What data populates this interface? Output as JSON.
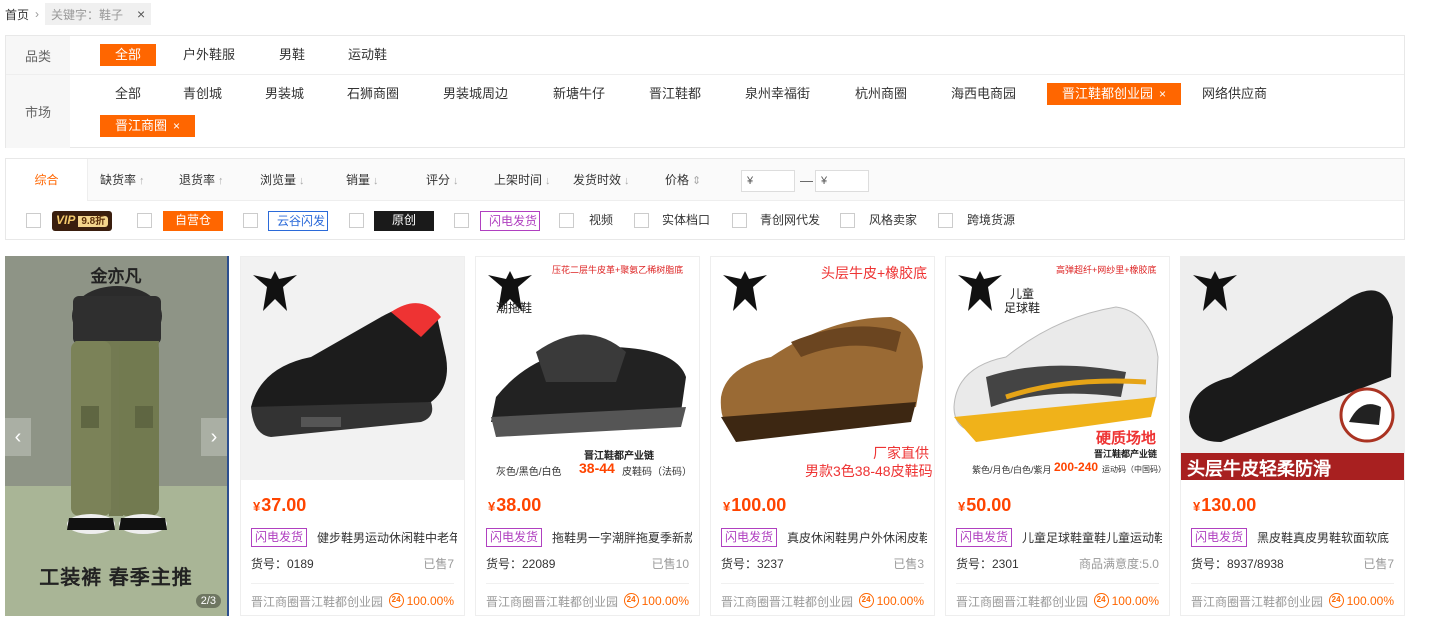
{
  "breadcrumb": {
    "home": "首页",
    "sep": "›",
    "keyword": "关键字：鞋子",
    "close": "×"
  },
  "filters": {
    "category": {
      "label": "品类",
      "options": [
        "全部",
        "户外鞋服",
        "男鞋",
        "运动鞋"
      ],
      "selected": "全部"
    },
    "market": {
      "label": "市场",
      "options": [
        "全部",
        "青创城",
        "男装城",
        "石狮商圈",
        "男装城周边",
        "新塘牛仔",
        "晋江鞋都",
        "泉州幸福街",
        "杭州商圈",
        "海西电商园",
        "晋江鞋都创业园",
        "网络供应商",
        "晋江商圈"
      ],
      "selected": [
        "晋江鞋都创业园",
        "晋江商圈"
      ],
      "remove_icon": "×"
    }
  },
  "sort": {
    "items": [
      "综合",
      "缺货率",
      "退货率",
      "浏览量",
      "销量",
      "评分",
      "上架时间",
      "发货时效",
      "价格"
    ],
    "arrows": [
      "↑",
      "↑",
      "↓",
      "↓",
      "↓",
      "↓",
      "↓",
      "⇕"
    ],
    "price_min_placeholder": "¥",
    "price_max_placeholder": "¥",
    "price_dash": "—"
  },
  "checks": {
    "vip": "VIP",
    "vip_discount": "9.8折",
    "ziying": "自营仓",
    "yungu": "云谷闪发",
    "yuanchuang": "原创",
    "shandian": "闪电发货",
    "video": "视频",
    "shiti": "实体档口",
    "qingchuang": "青创网代发",
    "fengge": "风格卖家",
    "kuajing": "跨境货源"
  },
  "banner": {
    "name": "金亦凡",
    "slogan": "工装裤  春季主推",
    "page": "2/3",
    "prev": "‹",
    "next": "›"
  },
  "products": [
    {
      "price": "37.00",
      "tag": "闪电发货",
      "title": "健步鞋男运动休闲鞋中老年",
      "code": "货号：0189",
      "sold": "已售7",
      "shop": "晋江商圈晋江鞋都创业园",
      "rate": "100.00%",
      "img_texts": []
    },
    {
      "price": "38.00",
      "tag": "闪电发货",
      "title": "拖鞋男一字潮胖拖夏季新款",
      "code": "货号：22089",
      "sold": "已售10",
      "shop": "晋江商圈晋江鞋都创业园",
      "rate": "100.00%",
      "img_texts": [
        "压花二层牛皮革+聚氨乙稀树脂底",
        "潮拖鞋",
        "晋江鞋都产业链",
        "灰色/黑色/白色",
        "38-44",
        "皮鞋码（法码）"
      ]
    },
    {
      "price": "100.00",
      "tag": "闪电发货",
      "title": "真皮休闲鞋男户外休闲皮鞋",
      "code": "货号：3237",
      "sold": "已售3",
      "shop": "晋江商圈晋江鞋都创业园",
      "rate": "100.00%",
      "img_texts": [
        "头层牛皮+橡胶底",
        "厂家直供",
        "男款3色38-48皮鞋码"
      ]
    },
    {
      "price": "50.00",
      "tag": "闪电发货",
      "title": "儿童足球鞋童鞋儿童运动鞋",
      "code": "货号：2301",
      "sold": "商品满意度:5.0",
      "shop": "晋江商圈晋江鞋都创业园",
      "rate": "100.00%",
      "img_texts": [
        "高弹超纤+网纱里+橡胶底",
        "儿童",
        "足球鞋",
        "硬质场地",
        "晋江鞋都产业链",
        "紫色/月色/白色/紫月",
        "200-240",
        "运动码（中国码）"
      ]
    },
    {
      "price": "130.00",
      "tag": "闪电发货",
      "title": "黑皮鞋真皮男鞋软面软底",
      "code": "货号：8937/8938",
      "sold": "已售7",
      "shop": "晋江商圈晋江鞋都创业园",
      "rate": "100.00%",
      "img_texts": [
        "头层牛皮轻柔防滑"
      ]
    }
  ],
  "currency": "¥",
  "rate_icon": "24"
}
